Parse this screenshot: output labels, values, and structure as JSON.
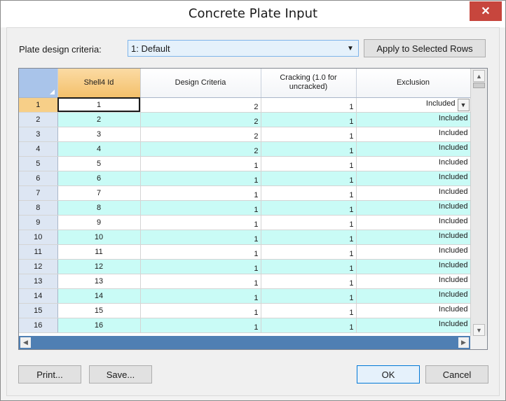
{
  "window": {
    "title": "Concrete Plate Input",
    "close_glyph": "✕"
  },
  "criteria": {
    "label": "Plate design criteria:",
    "selected": "1: Default",
    "apply_label": "Apply to Selected Rows"
  },
  "table": {
    "headers": [
      "Shell4 Id",
      "Design Criteria",
      "Cracking (1.0 for uncracked)",
      "Exclusion"
    ],
    "rows": [
      {
        "row": "1",
        "id": "1",
        "criteria": "2",
        "cracking": "1",
        "exclusion": "Included"
      },
      {
        "row": "2",
        "id": "2",
        "criteria": "2",
        "cracking": "1",
        "exclusion": "Included"
      },
      {
        "row": "3",
        "id": "3",
        "criteria": "2",
        "cracking": "1",
        "exclusion": "Included"
      },
      {
        "row": "4",
        "id": "4",
        "criteria": "2",
        "cracking": "1",
        "exclusion": "Included"
      },
      {
        "row": "5",
        "id": "5",
        "criteria": "1",
        "cracking": "1",
        "exclusion": "Included"
      },
      {
        "row": "6",
        "id": "6",
        "criteria": "1",
        "cracking": "1",
        "exclusion": "Included"
      },
      {
        "row": "7",
        "id": "7",
        "criteria": "1",
        "cracking": "1",
        "exclusion": "Included"
      },
      {
        "row": "8",
        "id": "8",
        "criteria": "1",
        "cracking": "1",
        "exclusion": "Included"
      },
      {
        "row": "9",
        "id": "9",
        "criteria": "1",
        "cracking": "1",
        "exclusion": "Included"
      },
      {
        "row": "10",
        "id": "10",
        "criteria": "1",
        "cracking": "1",
        "exclusion": "Included"
      },
      {
        "row": "11",
        "id": "11",
        "criteria": "1",
        "cracking": "1",
        "exclusion": "Included"
      },
      {
        "row": "12",
        "id": "12",
        "criteria": "1",
        "cracking": "1",
        "exclusion": "Included"
      },
      {
        "row": "13",
        "id": "13",
        "criteria": "1",
        "cracking": "1",
        "exclusion": "Included"
      },
      {
        "row": "14",
        "id": "14",
        "criteria": "1",
        "cracking": "1",
        "exclusion": "Included"
      },
      {
        "row": "15",
        "id": "15",
        "criteria": "1",
        "cracking": "1",
        "exclusion": "Included"
      },
      {
        "row": "16",
        "id": "16",
        "criteria": "1",
        "cracking": "1",
        "exclusion": "Included"
      }
    ]
  },
  "buttons": {
    "print": "Print...",
    "save": "Save...",
    "ok": "OK",
    "cancel": "Cancel"
  },
  "icons": {
    "combo_arrow": "chevron-down-icon",
    "cell_dropdown": "chevron-down-icon",
    "scroll_up": "arrow-up-icon",
    "scroll_down": "arrow-down-icon",
    "scroll_left": "arrow-left-icon",
    "scroll_right": "arrow-right-icon"
  },
  "colors": {
    "close_button": "#c7463d",
    "selected_header": "#f4c06b",
    "alternate_row": "#c9fbf6",
    "row_header": "#dde6f3",
    "horizontal_scrollbar": "#4f7fb3"
  }
}
